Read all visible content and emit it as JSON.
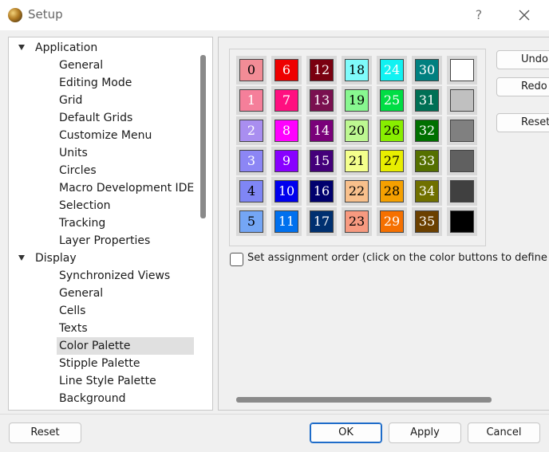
{
  "window": {
    "title": "Setup",
    "help_label": "?"
  },
  "tree": [
    {
      "label": "Application",
      "level": 0,
      "expanded": true
    },
    {
      "label": "General",
      "level": 1
    },
    {
      "label": "Editing Mode",
      "level": 1
    },
    {
      "label": "Grid",
      "level": 1
    },
    {
      "label": "Default Grids",
      "level": 1
    },
    {
      "label": "Customize Menu",
      "level": 1
    },
    {
      "label": "Units",
      "level": 1
    },
    {
      "label": "Circles",
      "level": 1
    },
    {
      "label": "Macro Development IDE",
      "level": 1
    },
    {
      "label": "Selection",
      "level": 1
    },
    {
      "label": "Tracking",
      "level": 1
    },
    {
      "label": "Layer Properties",
      "level": 1
    },
    {
      "label": "Display",
      "level": 0,
      "expanded": true
    },
    {
      "label": "Synchronized Views",
      "level": 1
    },
    {
      "label": "General",
      "level": 1
    },
    {
      "label": "Cells",
      "level": 1
    },
    {
      "label": "Texts",
      "level": 1
    },
    {
      "label": "Color Palette",
      "level": 1,
      "selected": true
    },
    {
      "label": "Stipple Palette",
      "level": 1
    },
    {
      "label": "Line Style Palette",
      "level": 1
    },
    {
      "label": "Background",
      "level": 1
    }
  ],
  "palette": {
    "columns": [
      [
        {
          "label": "0",
          "color": "#f28c96",
          "text": "#000000"
        },
        {
          "label": "1",
          "color": "#f57f9a",
          "text": "#ffffff"
        },
        {
          "label": "2",
          "color": "#a98ef0",
          "text": "#ffffff"
        },
        {
          "label": "3",
          "color": "#8c86f5",
          "text": "#ffffff"
        },
        {
          "label": "4",
          "color": "#7f86f5",
          "text": "#000000"
        },
        {
          "label": "5",
          "color": "#74a6f5",
          "text": "#000000"
        }
      ],
      [
        {
          "label": "6",
          "color": "#ee0000",
          "text": "#ffffff"
        },
        {
          "label": "7",
          "color": "#ff0f80",
          "text": "#ffffff"
        },
        {
          "label": "8",
          "color": "#ff00ff",
          "text": "#ffffff"
        },
        {
          "label": "9",
          "color": "#8800ff",
          "text": "#ffffff"
        },
        {
          "label": "10",
          "color": "#0000ee",
          "text": "#ffffff"
        },
        {
          "label": "11",
          "color": "#0070ee",
          "text": "#ffffff"
        }
      ],
      [
        {
          "label": "12",
          "color": "#7a0010",
          "text": "#ffffff"
        },
        {
          "label": "13",
          "color": "#7a1050",
          "text": "#ffffff"
        },
        {
          "label": "14",
          "color": "#7a007a",
          "text": "#ffffff"
        },
        {
          "label": "15",
          "color": "#44007a",
          "text": "#ffffff"
        },
        {
          "label": "16",
          "color": "#00006e",
          "text": "#ffffff"
        },
        {
          "label": "17",
          "color": "#003070",
          "text": "#ffffff"
        }
      ],
      [
        {
          "label": "18",
          "color": "#7ffbfb",
          "text": "#000000"
        },
        {
          "label": "19",
          "color": "#88f790",
          "text": "#000000"
        },
        {
          "label": "20",
          "color": "#bdf791",
          "text": "#000000"
        },
        {
          "label": "21",
          "color": "#f4ff8c",
          "text": "#000000"
        },
        {
          "label": "22",
          "color": "#f8c08c",
          "text": "#000000"
        },
        {
          "label": "23",
          "color": "#f79a80",
          "text": "#000000"
        }
      ],
      [
        {
          "label": "24",
          "color": "#11f2f2",
          "text": "#ffffff"
        },
        {
          "label": "25",
          "color": "#00dd44",
          "text": "#ffffff"
        },
        {
          "label": "26",
          "color": "#88ee00",
          "text": "#000000"
        },
        {
          "label": "27",
          "color": "#e8ee00",
          "text": "#000000"
        },
        {
          "label": "28",
          "color": "#f5a000",
          "text": "#000000"
        },
        {
          "label": "29",
          "color": "#f57000",
          "text": "#ffffff"
        }
      ],
      [
        {
          "label": "30",
          "color": "#008080",
          "text": "#ffffff"
        },
        {
          "label": "31",
          "color": "#007055",
          "text": "#ffffff"
        },
        {
          "label": "32",
          "color": "#007000",
          "text": "#ffffff"
        },
        {
          "label": "33",
          "color": "#557000",
          "text": "#ffffff"
        },
        {
          "label": "34",
          "color": "#707000",
          "text": "#ffffff"
        },
        {
          "label": "35",
          "color": "#6b4000",
          "text": "#ffffff"
        }
      ],
      [
        {
          "label": "",
          "color": "#ffffff",
          "text": "#000000"
        },
        {
          "label": "",
          "color": "#c0c0c0",
          "text": "#000000"
        },
        {
          "label": "",
          "color": "#808080",
          "text": "#000000"
        },
        {
          "label": "",
          "color": "#606060",
          "text": "#000000"
        },
        {
          "label": "",
          "color": "#404040",
          "text": "#000000"
        },
        {
          "label": "",
          "color": "#000000",
          "text": "#000000"
        }
      ]
    ]
  },
  "side_buttons": {
    "undo": "Undo",
    "redo": "Redo",
    "reset": "Reset"
  },
  "assignment_order": {
    "label": "Set assignment order (click on the color buttons to define order)",
    "checked": false
  },
  "footer": {
    "reset": "Reset",
    "ok": "OK",
    "apply": "Apply",
    "cancel": "Cancel"
  }
}
